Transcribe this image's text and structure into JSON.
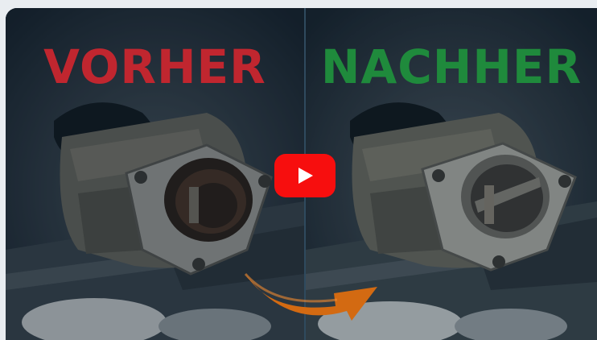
{
  "video": {
    "before_label": "VORHER",
    "after_label": "NACHHER",
    "play_icon": "youtube-play-icon",
    "arrow_icon": "curved-arrow-icon",
    "colors": {
      "before": "#c0262f",
      "after": "#1f8a3c",
      "play_button": "#f70e0e",
      "arrow": "#d36a12"
    }
  }
}
